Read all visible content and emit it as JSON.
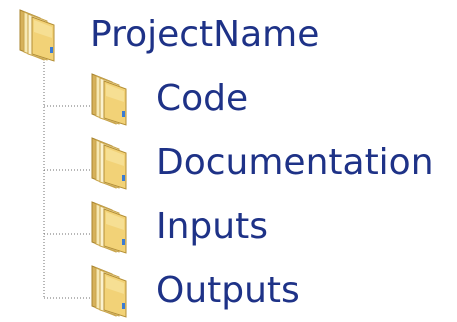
{
  "tree": {
    "root": {
      "label": "ProjectName",
      "icon": "folder-icon"
    },
    "children": [
      {
        "label": "Code",
        "icon": "folder-icon"
      },
      {
        "label": "Documentation",
        "icon": "folder-icon"
      },
      {
        "label": "Inputs",
        "icon": "folder-icon"
      },
      {
        "label": "Outputs",
        "icon": "folder-icon"
      }
    ]
  },
  "colors": {
    "label_text": "#1e3287",
    "folder_front": "#f2d277",
    "folder_back": "#caa24a",
    "connector": "#6f6f6f"
  }
}
